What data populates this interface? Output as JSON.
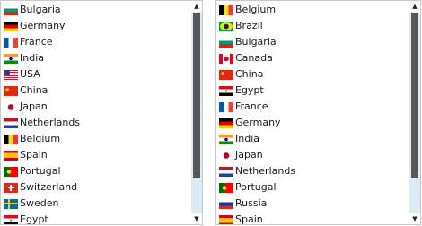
{
  "left_list": {
    "items": [
      {
        "label": "Bulgaria",
        "flag": "bulgaria-flag-icon"
      },
      {
        "label": "Germany",
        "flag": "germany-flag-icon"
      },
      {
        "label": "France",
        "flag": "france-flag-icon"
      },
      {
        "label": "India",
        "flag": "india-flag-icon"
      },
      {
        "label": "USA",
        "flag": "usa-flag-icon"
      },
      {
        "label": "China",
        "flag": "china-flag-icon"
      },
      {
        "label": "Japan",
        "flag": "japan-flag-icon"
      },
      {
        "label": "Netherlands",
        "flag": "netherlands-flag-icon"
      },
      {
        "label": "Belgium",
        "flag": "belgium-flag-icon"
      },
      {
        "label": "Spain",
        "flag": "spain-flag-icon"
      },
      {
        "label": "Portugal",
        "flag": "portugal-flag-icon"
      },
      {
        "label": "Switzerland",
        "flag": "switzerland-flag-icon"
      },
      {
        "label": "Sweden",
        "flag": "sweden-flag-icon"
      },
      {
        "label": "Egypt",
        "flag": "egypt-flag-icon"
      }
    ],
    "scroll_up_icon": "▲",
    "scroll_down_icon": "▼"
  },
  "right_list": {
    "items": [
      {
        "label": "Belgium",
        "flag": "belgium-flag-icon"
      },
      {
        "label": "Brazil",
        "flag": "brazil-flag-icon"
      },
      {
        "label": "Bulgaria",
        "flag": "bulgaria-flag-icon"
      },
      {
        "label": "Canada",
        "flag": "canada-flag-icon"
      },
      {
        "label": "China",
        "flag": "china-flag-icon"
      },
      {
        "label": "Egypt",
        "flag": "egypt-flag-icon"
      },
      {
        "label": "France",
        "flag": "france-flag-icon"
      },
      {
        "label": "Germany",
        "flag": "germany-flag-icon"
      },
      {
        "label": "India",
        "flag": "india-flag-icon"
      },
      {
        "label": "Japan",
        "flag": "japan-flag-icon"
      },
      {
        "label": "Netherlands",
        "flag": "netherlands-flag-icon"
      },
      {
        "label": "Portugal",
        "flag": "portugal-flag-icon"
      },
      {
        "label": "Russia",
        "flag": "russia-flag-icon"
      },
      {
        "label": "Spain",
        "flag": "spain-flag-icon"
      }
    ],
    "scroll_up_icon": "▲",
    "scroll_down_icon": "▼"
  },
  "colors": {
    "scrollbar_track": "#dcecf7",
    "scrollbar_thumb": "#575757",
    "border": "#c9c9c9"
  }
}
